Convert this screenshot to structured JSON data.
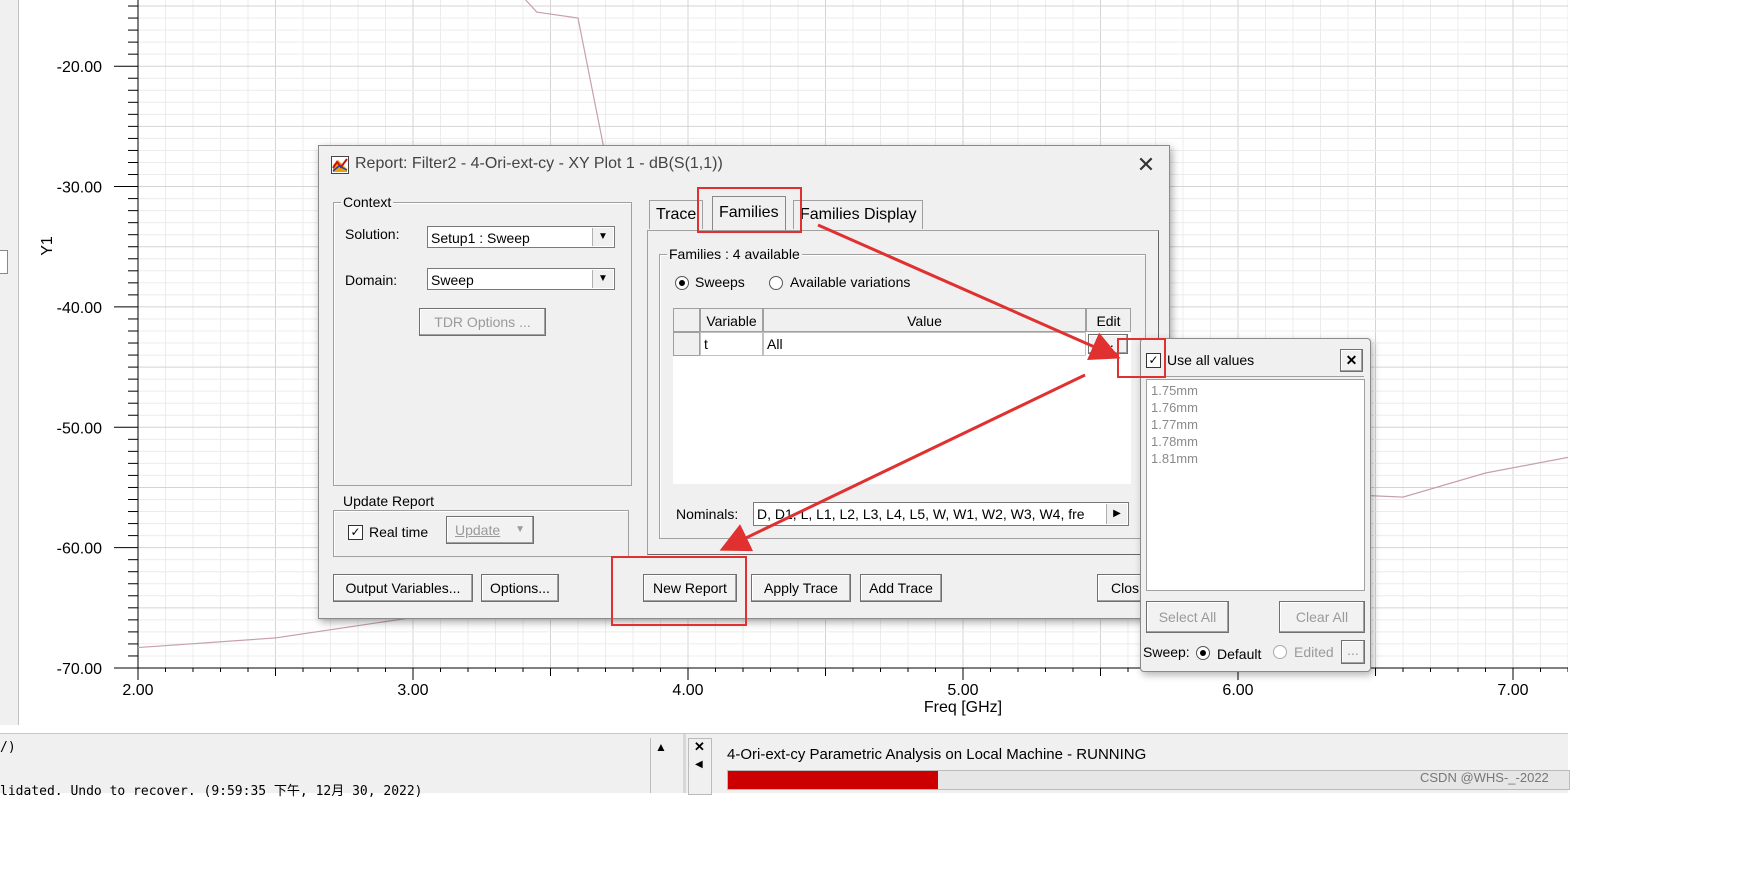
{
  "chart_data": {
    "type": "line",
    "xlabel": "Freq [GHz]",
    "ylabel": "Y1",
    "xlim": [
      2.0,
      7.2
    ],
    "ylim": [
      -70.0,
      -15.0
    ],
    "x_ticks": [
      "2.00",
      "3.00",
      "4.00",
      "5.00",
      "6.00",
      "7.00"
    ],
    "y_ticks": [
      "-20.00",
      "-30.00",
      "-40.00",
      "-50.00",
      "-60.00",
      "-70.00"
    ],
    "grid": true,
    "series": [
      {
        "color": "#c8a0a8",
        "x": [
          2.0,
          2.5,
          3.0,
          3.4,
          3.6
        ],
        "y": [
          -68.3,
          -67.5,
          -65.8,
          -60.0,
          -52.0
        ]
      },
      {
        "color": "#c8a0a8",
        "x": [
          3.35,
          3.45,
          3.6,
          3.7
        ],
        "y": [
          -13.0,
          -15.5,
          -16.0,
          -27.5
        ]
      },
      {
        "color": "#c8a0a8",
        "x": [
          6.3,
          6.6,
          6.9,
          7.2
        ],
        "y": [
          -55.5,
          -55.8,
          -53.8,
          -52.5
        ]
      }
    ]
  },
  "dialog": {
    "title": "Report: Filter2 - 4-Ori-ext-cy - XY Plot 1 - dB(S(1,1))",
    "close_glyph": "✕",
    "context_legend": "Context",
    "solution_label": "Solution:",
    "solution_value": "Setup1 : Sweep",
    "domain_label": "Domain:",
    "domain_value": "Sweep",
    "tdr_button": "TDR Options ...",
    "update_legend": "Update Report",
    "realtime_label": "Real time",
    "update_button": "Update",
    "tabs": [
      "Trace",
      "Families",
      "Families Display"
    ],
    "families_legend": "Families : 4 available",
    "radio_sweeps": "Sweeps",
    "radio_variations": "Available variations",
    "col_variable": "Variable",
    "col_value": "Value",
    "col_edit": "Edit",
    "row_variable": "t",
    "row_value": "All",
    "row_edit": "...",
    "nominals_label": "Nominals:",
    "nominals_value": "D, D1, L, L1, L2, L3, L4, L5, W, W1, W2, W3, W4, fre",
    "output_variables_button": "Output Variables...",
    "options_button": "Options...",
    "new_report_button": "New Report",
    "apply_trace_button": "Apply Trace",
    "add_trace_button": "Add Trace",
    "close_button": "Clos"
  },
  "popup": {
    "use_all_label": "Use all values",
    "close_glyph": "✕",
    "values": [
      "1.75mm",
      "1.76mm",
      "1.77mm",
      "1.78mm",
      "1.81mm"
    ],
    "select_all": "Select All",
    "clear_all": "Clear All",
    "sweep_label": "Sweep:",
    "default_label": "Default",
    "edited_label": "Edited",
    "more": "..."
  },
  "status": {
    "left_prefix": "/)",
    "log_line": "lidated. Undo to recover. (9:59:35 下午, 12月 30, 2022)",
    "progress_title": "4-Ori-ext-cy Parametric Analysis on Local Machine - RUNNING",
    "progress": 0.25,
    "watermark": "CSDN @WHS-_-2022",
    "progress_color": "#cc0000"
  },
  "annotation_color": "#e03030"
}
